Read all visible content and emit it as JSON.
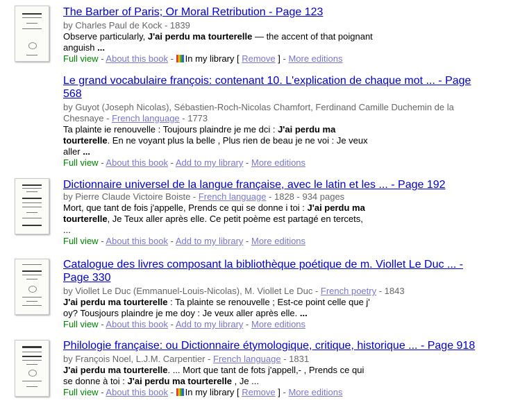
{
  "results": [
    {
      "title": "The Barber of Paris; Or Moral Retribution - Page 123",
      "byline_prefix": "by Charles Paul de Kock - 1839",
      "snippet_lines": [
        [
          "Observe particularly, ",
          "J'ai perdu ma tourterelle",
          " — the accent of that poignant"
        ],
        [
          "anguish ",
          "...",
          ""
        ]
      ],
      "full_view": "Full view",
      "about": "About this book",
      "library": "In my library [ ",
      "remove": "Remove",
      "library_end": " ]",
      "more": "More editions"
    },
    {
      "title_line1": "Le grand vocabulaire françois: contenant 10. L'explication de chaque mot ... - Page",
      "title_line2": "568",
      "byline_line1": "by Guyot (Joseph Nicolas), Sébastien-Roch-Nicolas Chamfort, Ferdinand Camille Duchemin de la",
      "byline_line2_prefix": "Chesnaye - ",
      "subject": "French language",
      "byline_line2_suffix": " - 1773",
      "snippet_lines": [
        [
          "Ta plainte ie renouvelle : Toujours plaindre je me dci : ",
          "J'ai perdu ma",
          ""
        ],
        [
          "",
          "tourterelle",
          ". En ne voyant plus la belle , Plus rien de beau je ne voi : Je veux"
        ],
        [
          "aller ",
          "...",
          ""
        ]
      ],
      "full_view": "Full view",
      "about": "About this book",
      "add": "Add to my library",
      "more": "More editions"
    },
    {
      "title": "Dictionnaire universel de la langue française, avec le latin et les ... - Page 192",
      "byline_prefix": "by Pierre Claude Victoire Boiste - ",
      "subject": "French language",
      "byline_suffix": " - 1828 - 934 pages",
      "snippet_lines": [
        [
          "Mort, que tant de fois j'appelle, Prends ce qui se donne i toi : ",
          "J'ai perdu ma",
          ""
        ],
        [
          "",
          "tourterelle",
          ", Je Teux aller après elle. Ce petit poème est partagé en tercets,"
        ],
        [
          "...",
          "",
          ""
        ]
      ],
      "full_view": "Full view",
      "about": "About this book",
      "add": "Add to my library",
      "more": "More editions"
    },
    {
      "title_line1": "Catalogue des livres composant la bibliothèque poétique de m. Viollet Le Duc ... -",
      "title_line2": "Page 330",
      "byline_prefix": "by Viollet Le Duc (Emmanuel-Louis-Nicolas), M. Viollet Le Duc - ",
      "subject": "French poetry",
      "byline_suffix": " - 1843",
      "snippet_lines": [
        [
          "",
          "J'ai perdu ma tourterelle",
          " : Ta plainte se renouvelle ; Est-ce point celle que j'"
        ],
        [
          "oy? Tousjours plaindre je me doy : Je veux aller après elle. ",
          "...",
          ""
        ]
      ],
      "full_view": "Full view",
      "about": "About this book",
      "add": "Add to my library",
      "more": "More editions"
    },
    {
      "title": "Philologie française: ou Dictionnaire étymologique, critique, historique ... - Page 918",
      "byline_prefix": "by François Noel, L.J.M. Carpentier - ",
      "subject": "French language",
      "byline_suffix": " - 1831",
      "snippet_lines": [
        [
          "",
          "J'ai perdu ma tourterelle",
          ". ... Mort que tant de fots j'appell,- , Prends ce qui"
        ],
        [
          "se donne à toi : ",
          "J'ai perdu ma tourterelle",
          " , Je ..."
        ]
      ],
      "full_view": "Full view",
      "about": "About this book",
      "library": "In my library [ ",
      "remove": "Remove",
      "library_end": " ]",
      "more": "More editions"
    }
  ],
  "colors": {
    "title_link": "#0000cc",
    "minor_link": "#7777cc",
    "full_view": "#008000",
    "byline": "#666666"
  },
  "icons": [
    "book-cover-thumbnail",
    "my-library-icon"
  ]
}
